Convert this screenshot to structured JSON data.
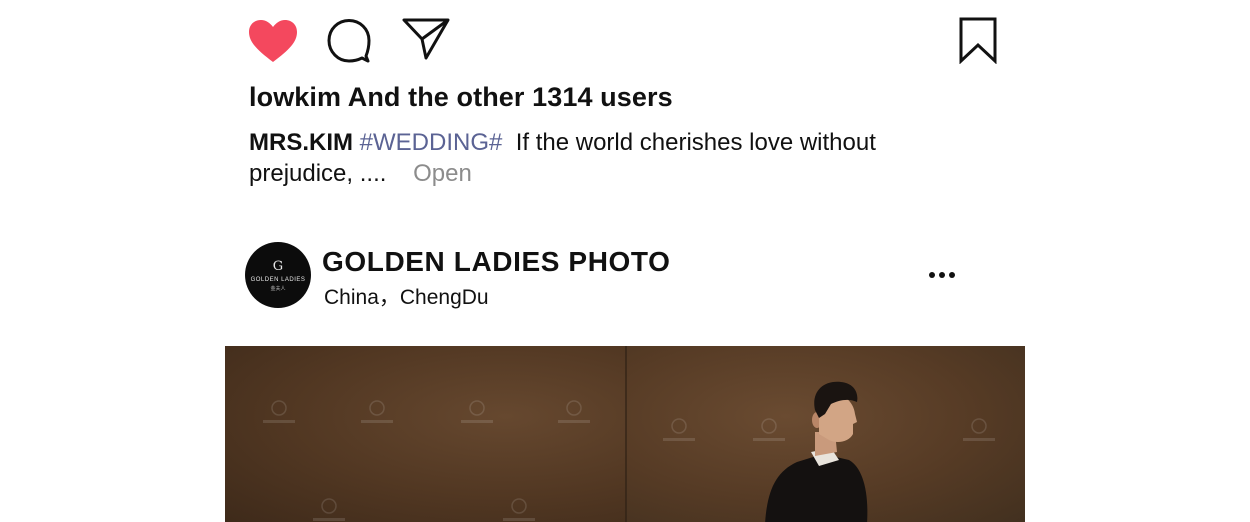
{
  "actions": {
    "like_icon": "heart-filled",
    "like_color": "#f4485e",
    "comment_icon": "speech-bubble",
    "share_icon": "paper-plane",
    "save_icon": "bookmark"
  },
  "likes": {
    "text": "lowkim And the other 1314 users"
  },
  "caption": {
    "author": "MRS.KIM",
    "hashtag": "#WEDDING#",
    "hashtag_color": "#5b6394",
    "text": "If the world cherishes love without prejudice, ....",
    "more_label": "Open"
  },
  "post": {
    "account_name": "GOLDEN LADIES PHOTO",
    "location": "China，ChengDu",
    "avatar": {
      "monogram": "G",
      "brand": "GOLDEN LADIES",
      "sub": "金夫人"
    },
    "more_icon": "ellipsis-horizontal"
  },
  "photo": {
    "description": "wedding portrait, brown studio backdrop",
    "backdrop_color": "#553c29"
  }
}
